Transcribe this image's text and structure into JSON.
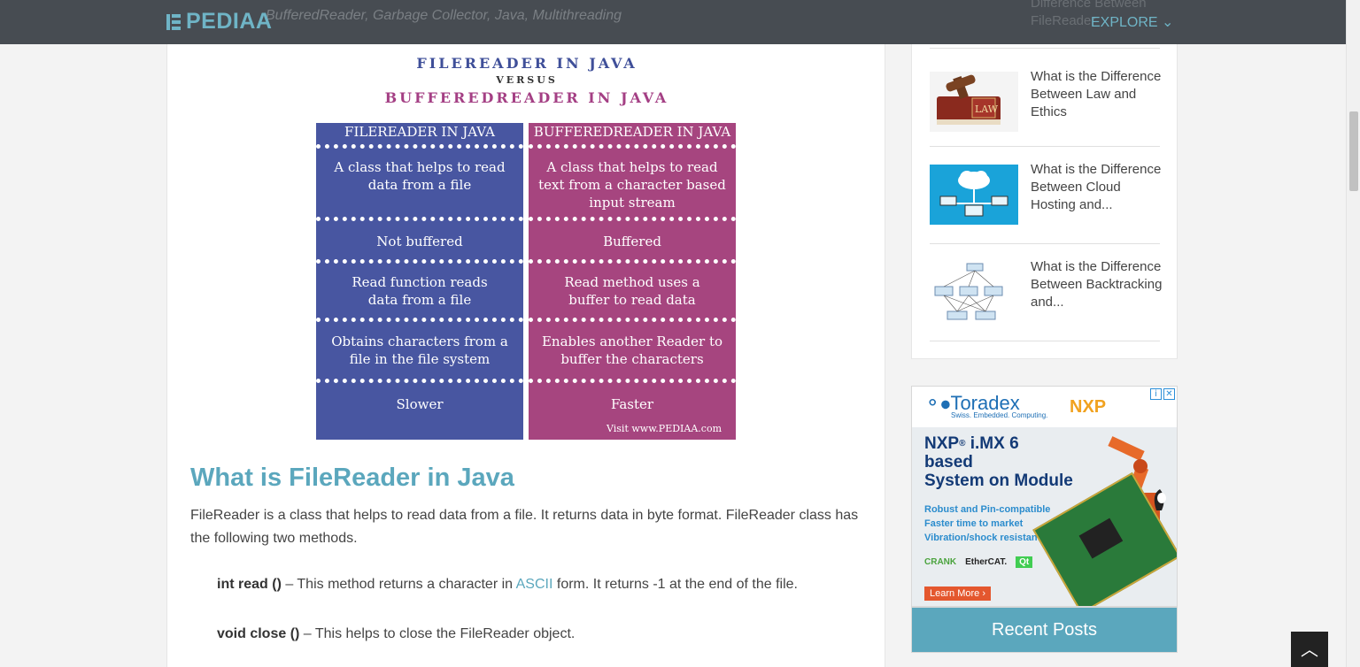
{
  "header": {
    "logo": "PEDIAA",
    "faded_tags": "BufferedReader, Garbage Collector, Java, Multithreading",
    "faded_side_text": "Difference Between FileReader",
    "explore_label": "EXPLORE",
    "explore_icon": "chevron-down-icon"
  },
  "infographic": {
    "title_line1": "FILEREADER IN JAVA",
    "title_line2": "VERSUS",
    "title_line3": "BUFFEREDREADER IN JAVA",
    "left_header": "FILEREADER IN JAVA",
    "right_header": "BUFFEREDREADER IN JAVA",
    "rows": [
      {
        "left": "A class that helps to read data from a file",
        "right": "A class that helps to read text from a character based input stream"
      },
      {
        "left": "Not buffered",
        "right": "Buffered"
      },
      {
        "left": "Read function reads data from a file",
        "right": "Read method uses a buffer to read data"
      },
      {
        "left": "Obtains characters from a file in the file system",
        "right": "Enables another Reader to buffer the characters"
      },
      {
        "left": "Slower",
        "right": "Faster"
      }
    ],
    "credit": "Visit www.PEDIAA.com",
    "left_color": "#4856a1",
    "right_color": "#a6457f"
  },
  "article": {
    "heading": "What is FileReader in Java",
    "paragraph": "FileReader is a class that helps to read data from a file. It returns data in byte format. FileReader class has the following two methods.",
    "methods": [
      {
        "name": "int read ()",
        "text_before": " – This method returns a character in ",
        "link": "ASCII",
        "text_after": " form. It returns -1 at the end of the file."
      },
      {
        "name": "void close ()",
        "text_before": " – This helps to close the FileReader object.",
        "link": "",
        "text_after": ""
      }
    ]
  },
  "sidebar": {
    "posts": [
      {
        "title": "What is the Difference Between Law and Ethics",
        "thumb": "law-book-gavel-image"
      },
      {
        "title": "What is the Difference Between Cloud Hosting and...",
        "thumb": "cloud-hosting-image"
      },
      {
        "title": "What is the Difference Between Backtracking and...",
        "thumb": "backtracking-diagram-image"
      }
    ]
  },
  "ad": {
    "brand": "Toradex",
    "tagline": "Swiss. Embedded. Computing.",
    "partner": "NXP",
    "headline_brand": "NXP",
    "headline_chip": "i.MX 6",
    "headline_rest": [
      "based",
      "System on Module"
    ],
    "features": [
      "Robust and Pin-compatible",
      "Faster time to market",
      "Vibration/shock resistant"
    ],
    "partner_logos": [
      "CRANK",
      "EtherCAT.",
      "Qt"
    ],
    "cta": "Learn More",
    "info_icon": "info-icon",
    "close_icon": "close-icon"
  },
  "recent_posts_label": "Recent Posts",
  "back_to_top_icon": "chevron-up-icon"
}
